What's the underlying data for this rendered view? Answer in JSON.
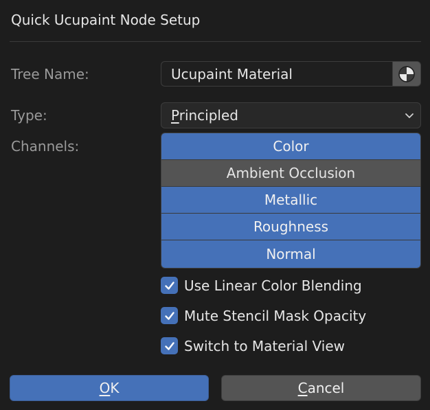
{
  "dialog": {
    "title": "Quick Ucupaint Node Setup"
  },
  "tree_name": {
    "label": "Tree Name:",
    "value": "Ucupaint Material",
    "icon": "material-sphere-icon"
  },
  "type": {
    "label": "Type:",
    "selected_accel": "P",
    "selected_rest": "rincipled"
  },
  "channels": {
    "label": "Channels:",
    "items": [
      {
        "label": "Color",
        "enabled": true
      },
      {
        "label": "Ambient Occlusion",
        "enabled": false
      },
      {
        "label": "Metallic",
        "enabled": true
      },
      {
        "label": "Roughness",
        "enabled": true
      },
      {
        "label": "Normal",
        "enabled": true
      }
    ]
  },
  "options": [
    {
      "label": "Use Linear Color Blending",
      "checked": true
    },
    {
      "label": "Mute Stencil Mask Opacity",
      "checked": true
    },
    {
      "label": "Switch to Material View",
      "checked": true
    }
  ],
  "buttons": {
    "ok_accel": "O",
    "ok_rest": "K",
    "cancel_accel": "C",
    "cancel_rest": "ancel"
  },
  "colors": {
    "accent": "#4571b8",
    "background": "#1d1d1d",
    "disabled_toggle": "#545454"
  }
}
